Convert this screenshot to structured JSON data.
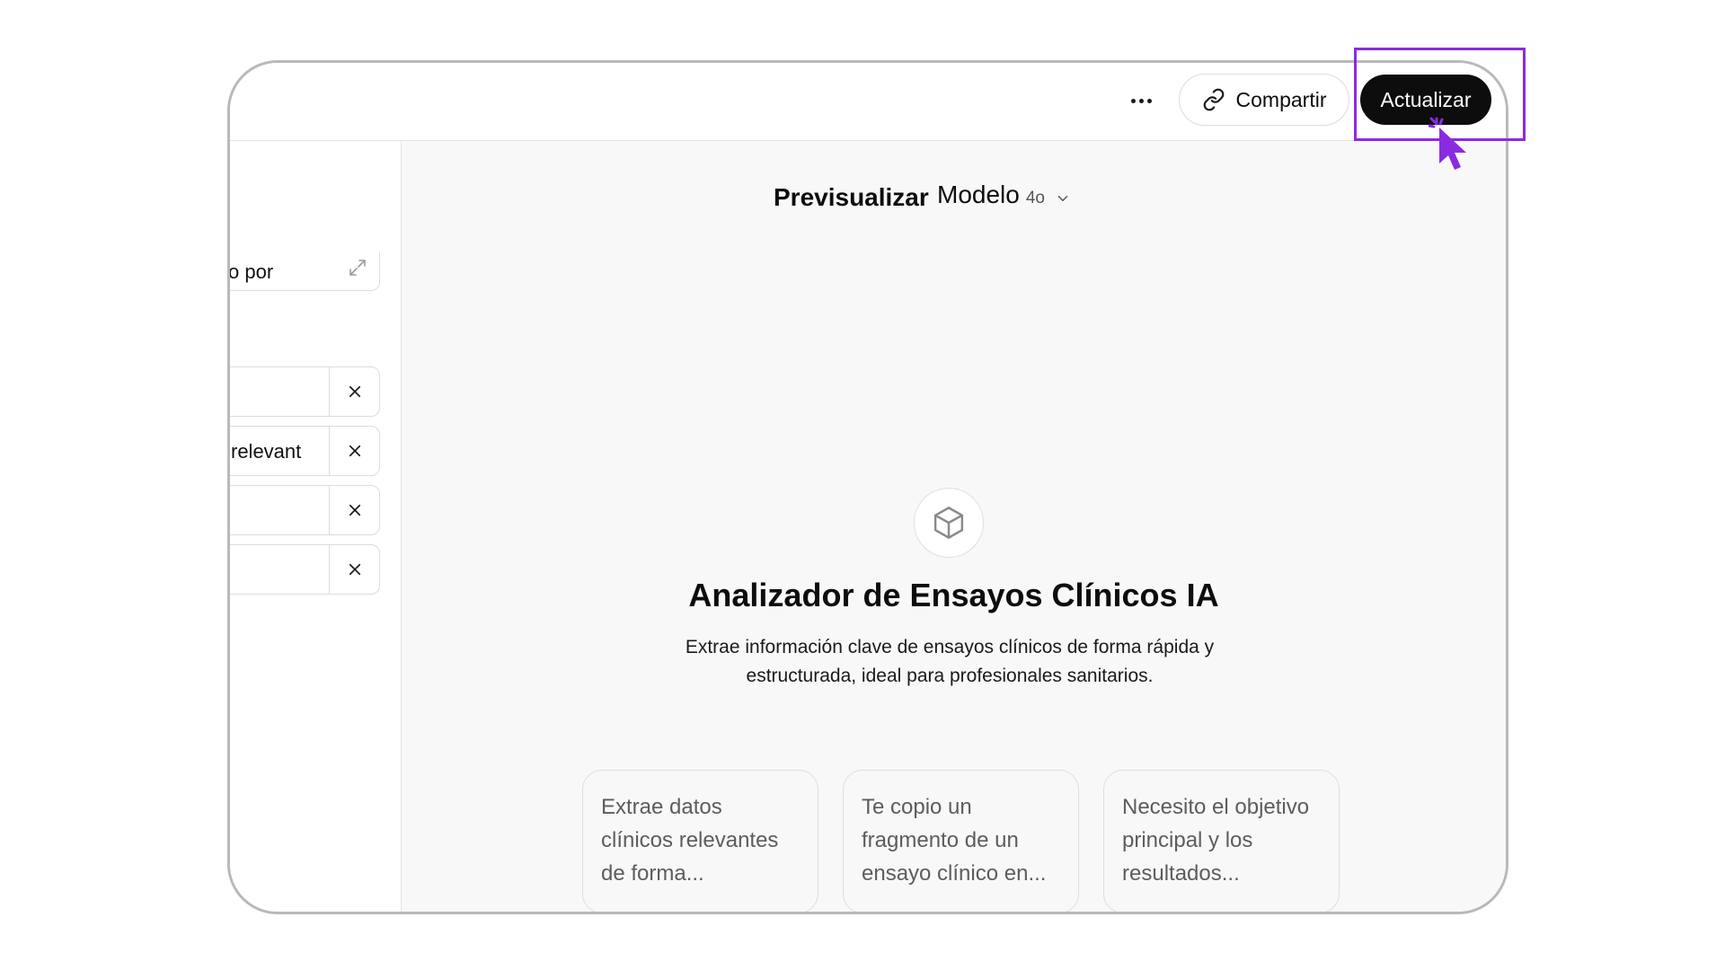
{
  "header": {
    "more_label": "…",
    "share_label": "Compartir",
    "update_label": "Actualizar"
  },
  "left_panel": {
    "description_text": "o por",
    "starter_rows": [
      {
        "text": ""
      },
      {
        "text": "relevant"
      },
      {
        "text": ""
      },
      {
        "text": ""
      }
    ],
    "select_value": ""
  },
  "preview": {
    "title": "Previsualizar",
    "model_label": "Modelo",
    "model_version": "4o",
    "gpt_icon": "cube-icon",
    "gpt_name": "Analizador de Ensayos Clínicos IA",
    "gpt_description": "Extrae información clave de ensayos clínicos de forma rápida y estructurada, ideal para profesionales sanitarios.",
    "conversation_starters": [
      "Extrae datos clínicos relevantes de forma...",
      "Te copio un fragmento de un ensayo clínico en...",
      "Necesito el objetivo principal y los resultados..."
    ]
  },
  "colors": {
    "accent_highlight": "#8a2be2",
    "update_button_bg": "#0d0d0d",
    "preview_bg": "#f8f8f8"
  }
}
